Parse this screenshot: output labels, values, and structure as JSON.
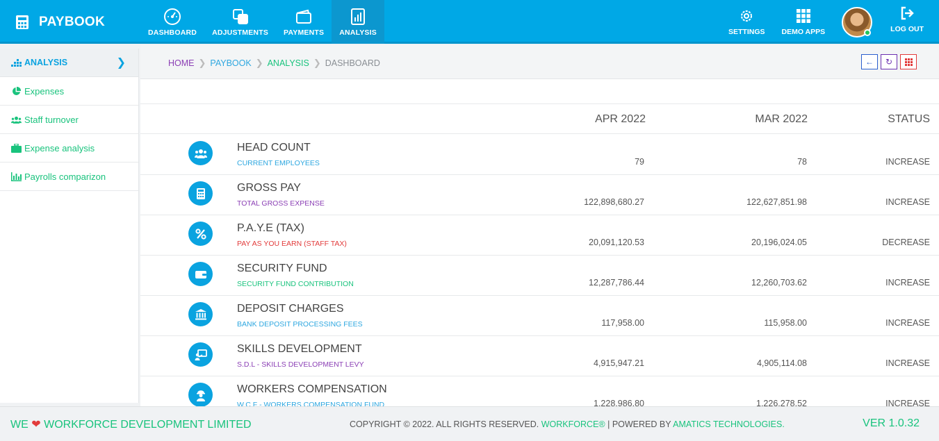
{
  "app": {
    "brand": "PAYBOOK",
    "nav": [
      {
        "label": "DASHBOARD",
        "icon": "speedometer-icon"
      },
      {
        "label": "ADJUSTMENTS",
        "icon": "layers-icon"
      },
      {
        "label": "PAYMENTS",
        "icon": "wallet-icon"
      },
      {
        "label": "ANALYSIS",
        "icon": "bar-chart-icon",
        "active": true
      }
    ],
    "right_nav": {
      "settings": "SETTINGS",
      "demo_apps": "DEMO APPS",
      "logout": "LOG OUT"
    }
  },
  "sidebar": {
    "header": "ANALYSIS",
    "items": [
      {
        "label": "Expenses",
        "icon": "pie-chart-icon"
      },
      {
        "label": "Staff turnover",
        "icon": "users-icon"
      },
      {
        "label": "Expense analysis",
        "icon": "briefcase-icon"
      },
      {
        "label": "Payrolls comparizon",
        "icon": "bar-chart-icon"
      }
    ]
  },
  "breadcrumb": [
    "HOME",
    "PAYBOOK",
    "ANALYSIS",
    "DASHBOARD"
  ],
  "table": {
    "headers": {
      "col1": "APR 2022",
      "col2": "MAR 2022",
      "status": "STATUS"
    },
    "rows": [
      {
        "title": "HEAD COUNT",
        "subtitle": "CURRENT EMPLOYEES",
        "subtitle_color": "#2ea7e0",
        "icon": "users-icon",
        "apr": "79",
        "mar": "78",
        "status": "INCREASE"
      },
      {
        "title": "GROSS PAY",
        "subtitle": "TOTAL GROSS EXPENSE",
        "subtitle_color": "#8b3fb5",
        "icon": "calculator-icon",
        "apr": "122,898,680.27",
        "mar": "122,627,851.98",
        "status": "INCREASE"
      },
      {
        "title": "P.A.Y.E (TAX)",
        "subtitle": "PAY AS YOU EARN (STAFF TAX)",
        "subtitle_color": "#e23b3b",
        "icon": "percent-icon",
        "apr": "20,091,120.53",
        "mar": "20,196,024.05",
        "status": "DECREASE"
      },
      {
        "title": "SECURITY FUND",
        "subtitle": "SECURITY FUND CONTRIBUTION",
        "subtitle_color": "#19c37d",
        "icon": "wallet-icon",
        "apr": "12,287,786.44",
        "mar": "12,260,703.62",
        "status": "INCREASE"
      },
      {
        "title": "DEPOSIT CHARGES",
        "subtitle": "BANK DEPOSIT PROCESSING FEES",
        "subtitle_color": "#2ea7e0",
        "icon": "bank-icon",
        "apr": "117,958.00",
        "mar": "115,958.00",
        "status": "INCREASE"
      },
      {
        "title": "SKILLS DEVELOPMENT",
        "subtitle": "S.D.L - SKILLS DEVELOPMENT LEVY",
        "subtitle_color": "#8b3fb5",
        "icon": "teacher-icon",
        "apr": "4,915,947.21",
        "mar": "4,905,114.08",
        "status": "INCREASE"
      },
      {
        "title": "WORKERS COMPENSATION",
        "subtitle": "W.C.F - WORKERS COMPENSATION FUND",
        "subtitle_color": "#2ea7e0",
        "icon": "worker-icon",
        "apr": "1,228,986.80",
        "mar": "1,226,278.52",
        "status": "INCREASE"
      }
    ]
  },
  "footer": {
    "left_pre": "WE",
    "left_post": "WORKFORCE DEVELOPMENT LIMITED",
    "copyright": "COPYRIGHT © 2022. ALL RIGHTS RESERVED.",
    "workforce": "WORKFORCE®",
    "powered": "| POWERED BY",
    "amatics": "AMATICS TECHNOLOGIES.",
    "version": "VER 1.0.32"
  },
  "colors": {
    "topbar": "#00a8e6",
    "accent_green": "#19c37d",
    "accent_blue": "#0aa3e0",
    "accent_purple": "#8b3fb5",
    "accent_red": "#e23b3b"
  }
}
